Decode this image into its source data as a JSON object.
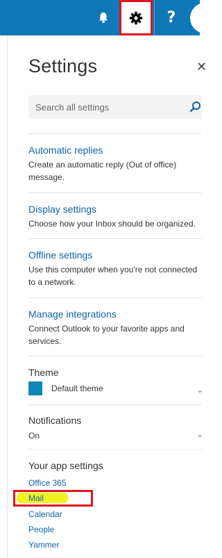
{
  "header": {
    "icons": [
      "bell-icon",
      "gear-icon",
      "help-icon",
      "avatar"
    ],
    "help_glyph": "?",
    "brand_color": "#0f78b6"
  },
  "settings": {
    "title": "Settings",
    "search_placeholder": "Search all settings",
    "items": [
      {
        "title": "Automatic replies",
        "description": "Create an automatic reply (Out of office) message."
      },
      {
        "title": "Display settings",
        "description": "Choose how your Inbox should be organized."
      },
      {
        "title": "Offline settings",
        "description": "Use this computer when you're not connected to a network."
      },
      {
        "title": "Manage integrations",
        "description": "Connect Outlook to your favorite apps and services."
      }
    ],
    "theme": {
      "label": "Theme",
      "value": "Default theme",
      "swatch_color": "#0f86b9"
    },
    "notifications": {
      "label": "Notifications",
      "value": "On"
    },
    "app_settings": {
      "label": "Your app settings",
      "links": [
        "Office 365",
        "Mail",
        "Calendar",
        "People",
        "Yammer"
      ],
      "highlighted": "Mail"
    }
  }
}
